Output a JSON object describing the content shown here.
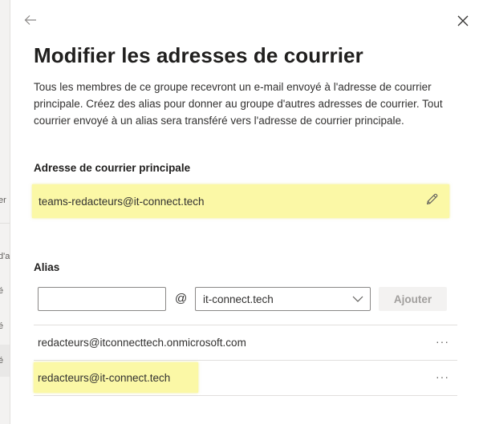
{
  "background": {
    "fragments": [
      "er",
      "d'a",
      "é",
      "é",
      "é"
    ]
  },
  "panel": {
    "title": "Modifier les adresses de courrier",
    "description": "Tous les membres de ce groupe recevront un e-mail envoyé à l'adresse de courrier principale. Créez des alias pour donner au groupe d'autres adresses de courrier. Tout courrier envoyé à un alias sera transféré vers l'adresse de courrier principale.",
    "back_icon": "arrow-left-icon",
    "close_icon": "close-icon"
  },
  "primary": {
    "label": "Adresse de courrier principale",
    "address": "teams-redacteurs@it-connect.tech",
    "edit_icon": "pencil-icon"
  },
  "alias": {
    "label": "Alias",
    "input_value": "",
    "at": "@",
    "domain_selected": "it-connect.tech",
    "add_label": "Ajouter",
    "items": [
      {
        "address": "redacteurs@itconnecttech.onmicrosoft.com",
        "more": "···"
      },
      {
        "address": "redacteurs@it-connect.tech",
        "more": "···"
      }
    ]
  },
  "colors": {
    "highlight": "#fbf8a6",
    "text": "#323130",
    "title": "#201f1e",
    "border": "#8a8886",
    "divider": "#e1dfdd",
    "disabled_bg": "#f3f2f1",
    "disabled_text": "#a19f9d"
  }
}
